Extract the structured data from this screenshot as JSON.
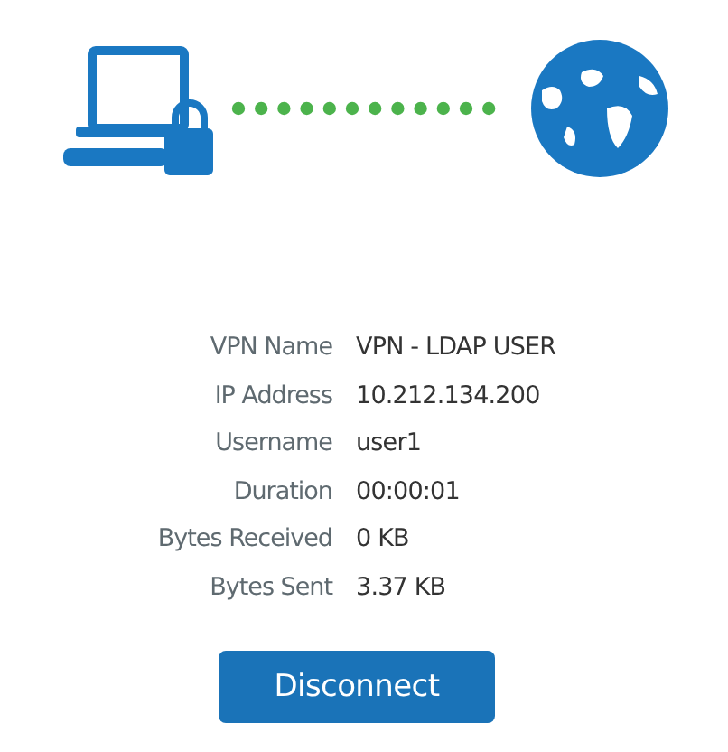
{
  "details": [
    {
      "label": "VPN Name",
      "value": "VPN - LDAP USER"
    },
    {
      "label": "IP Address",
      "value": "10.212.134.200"
    },
    {
      "label": "Username",
      "value": "user1"
    },
    {
      "label": "Duration",
      "value": "00:00:01"
    },
    {
      "label": "Bytes Received",
      "value": "0 KB"
    },
    {
      "label": "Bytes Sent",
      "value": "3.37 KB"
    }
  ],
  "button": "Disconnect"
}
